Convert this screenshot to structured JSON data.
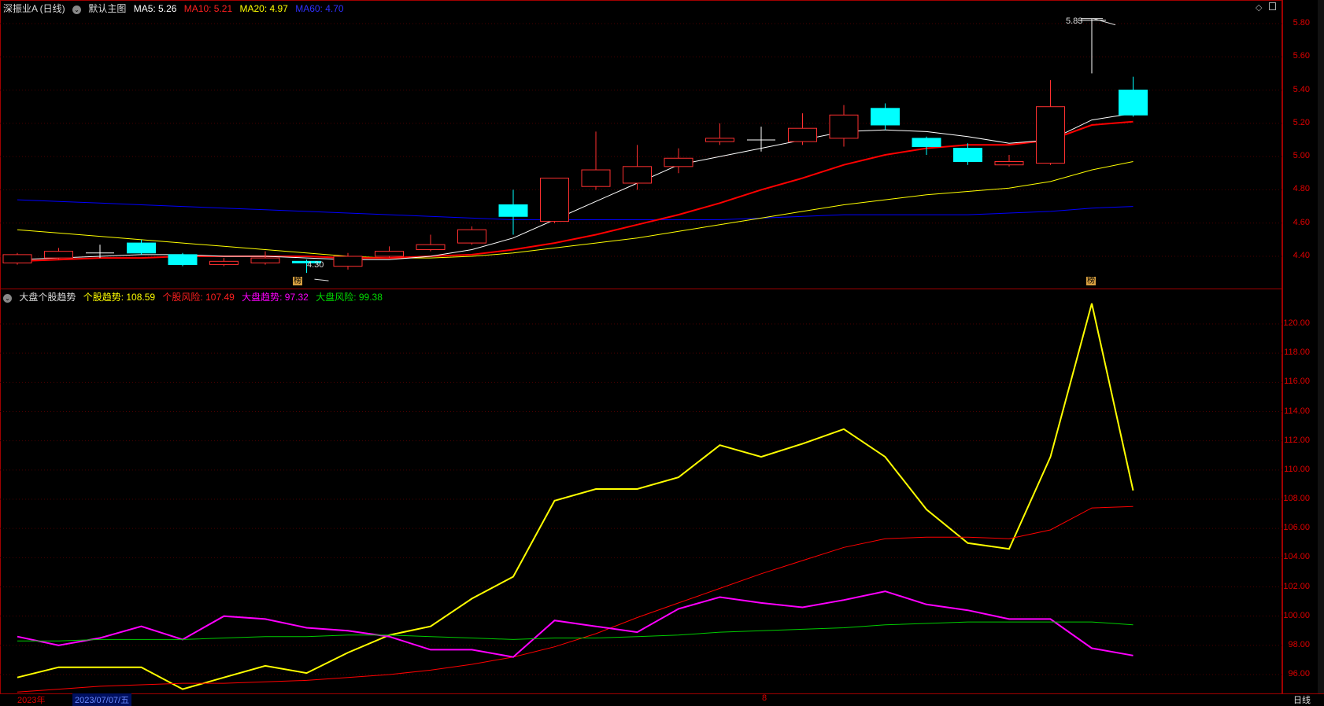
{
  "top_header": {
    "stock_name": "深振业A (日线)",
    "indicator_name": "默认主图",
    "ma5": "MA5: 5.26",
    "ma10": "MA10: 5.21",
    "ma20": "MA20: 4.97",
    "ma60": "MA60: 4.70"
  },
  "bottom_header": {
    "indicator_name": "大盘个股趋势",
    "stock_trend": "个股趋势: 108.59",
    "stock_risk": "个股风险: 107.49",
    "market_trend": "大盘趋势: 97.32",
    "market_risk": "大盘风险: 99.38"
  },
  "price_axis": [
    "5.80",
    "5.60",
    "5.40",
    "5.20",
    "5.00",
    "4.80",
    "4.60",
    "4.40"
  ],
  "indicator_axis": [
    "120.00",
    "118.00",
    "116.00",
    "114.00",
    "112.00",
    "110.00",
    "108.00",
    "106.00",
    "104.00",
    "102.00",
    "100.00",
    "98.00",
    "96.00"
  ],
  "annotations": {
    "high_label": "5.83",
    "low_label": "4.30",
    "tag_left": "榜",
    "tag_right": "榜"
  },
  "footer": {
    "year": "2023年",
    "date": "2023/07/07/五",
    "mid_marker": "8",
    "period": "日线"
  },
  "colors": {
    "up": "#ff3030",
    "down": "#00ffff",
    "ma5": "#ffffff",
    "ma10": "#ff0000",
    "ma20": "#ffff00",
    "ma60": "#0000ff",
    "stock_trend": "#ffff00",
    "stock_risk": "#ff0000",
    "market_trend": "#ff00ff",
    "market_risk": "#00cc00"
  },
  "chart_data": [
    {
      "type": "candlestick",
      "ylim": [
        4.3,
        5.85
      ],
      "candles": [
        {
          "o": 4.36,
          "c": 4.41,
          "h": 4.42,
          "l": 4.35
        },
        {
          "o": 4.39,
          "c": 4.43,
          "h": 4.45,
          "l": 4.38
        },
        {
          "o": 4.42,
          "c": 4.42,
          "h": 4.47,
          "l": 4.39
        },
        {
          "o": 4.48,
          "c": 4.42,
          "h": 4.5,
          "l": 4.41
        },
        {
          "o": 4.41,
          "c": 4.35,
          "h": 4.42,
          "l": 4.34
        },
        {
          "o": 4.35,
          "c": 4.37,
          "h": 4.39,
          "l": 4.34
        },
        {
          "o": 4.36,
          "c": 4.39,
          "h": 4.43,
          "l": 4.35
        },
        {
          "o": 4.37,
          "c": 4.36,
          "h": 4.38,
          "l": 4.3
        },
        {
          "o": 4.34,
          "c": 4.4,
          "h": 4.42,
          "l": 4.32
        },
        {
          "o": 4.4,
          "c": 4.43,
          "h": 4.46,
          "l": 4.39
        },
        {
          "o": 4.44,
          "c": 4.47,
          "h": 4.53,
          "l": 4.43
        },
        {
          "o": 4.48,
          "c": 4.56,
          "h": 4.58,
          "l": 4.47
        },
        {
          "o": 4.71,
          "c": 4.64,
          "h": 4.8,
          "l": 4.53
        },
        {
          "o": 4.61,
          "c": 4.87,
          "h": 4.87,
          "l": 4.6
        },
        {
          "o": 4.82,
          "c": 4.92,
          "h": 5.15,
          "l": 4.8
        },
        {
          "o": 4.84,
          "c": 4.94,
          "h": 5.07,
          "l": 4.8
        },
        {
          "o": 4.94,
          "c": 4.99,
          "h": 5.05,
          "l": 4.9
        },
        {
          "o": 5.09,
          "c": 5.11,
          "h": 5.2,
          "l": 5.07
        },
        {
          "o": 5.1,
          "c": 5.1,
          "h": 5.18,
          "l": 5.03
        },
        {
          "o": 5.09,
          "c": 5.17,
          "h": 5.26,
          "l": 5.07
        },
        {
          "o": 5.11,
          "c": 5.25,
          "h": 5.31,
          "l": 5.06
        },
        {
          "o": 5.29,
          "c": 5.19,
          "h": 5.32,
          "l": 5.16
        },
        {
          "o": 5.11,
          "c": 5.06,
          "h": 5.12,
          "l": 5.01
        },
        {
          "o": 5.05,
          "c": 4.97,
          "h": 5.08,
          "l": 4.95
        },
        {
          "o": 4.95,
          "c": 4.97,
          "h": 5.01,
          "l": 4.94
        },
        {
          "o": 4.96,
          "c": 5.3,
          "h": 5.46,
          "l": 4.95
        },
        {
          "o": 5.82,
          "c": 5.82,
          "h": 5.83,
          "l": 5.5
        },
        {
          "o": 5.4,
          "c": 5.25,
          "h": 5.48,
          "l": 5.24
        }
      ],
      "ma5": [
        4.38,
        4.39,
        4.4,
        4.41,
        4.41,
        4.4,
        4.4,
        4.39,
        4.38,
        4.38,
        4.4,
        4.44,
        4.51,
        4.62,
        4.73,
        4.84,
        4.95,
        5.0,
        5.05,
        5.1,
        5.15,
        5.16,
        5.15,
        5.12,
        5.08,
        5.1,
        5.22,
        5.26
      ],
      "ma10": [
        4.37,
        4.38,
        4.39,
        4.39,
        4.4,
        4.4,
        4.4,
        4.4,
        4.39,
        4.39,
        4.4,
        4.41,
        4.44,
        4.48,
        4.53,
        4.59,
        4.65,
        4.72,
        4.8,
        4.87,
        4.95,
        5.01,
        5.05,
        5.07,
        5.07,
        5.1,
        5.19,
        5.21
      ],
      "ma20": [
        4.56,
        4.54,
        4.52,
        4.5,
        4.48,
        4.46,
        4.44,
        4.42,
        4.4,
        4.39,
        4.39,
        4.4,
        4.42,
        4.45,
        4.48,
        4.51,
        4.55,
        4.59,
        4.63,
        4.67,
        4.71,
        4.74,
        4.77,
        4.79,
        4.81,
        4.85,
        4.92,
        4.97
      ],
      "ma60": [
        4.74,
        4.73,
        4.72,
        4.71,
        4.7,
        4.69,
        4.68,
        4.67,
        4.66,
        4.65,
        4.64,
        4.63,
        4.62,
        4.62,
        4.62,
        4.62,
        4.62,
        4.62,
        4.63,
        4.64,
        4.65,
        4.65,
        4.65,
        4.65,
        4.66,
        4.67,
        4.69,
        4.7
      ]
    },
    {
      "type": "line",
      "ylim": [
        94.8,
        122.5
      ],
      "series": [
        {
          "name": "个股趋势",
          "values": [
            95.8,
            96.5,
            96.5,
            96.5,
            95.0,
            95.8,
            96.6,
            96.1,
            97.5,
            98.7,
            99.3,
            101.2,
            102.7,
            107.9,
            108.7,
            108.7,
            109.5,
            111.7,
            110.9,
            111.8,
            112.8,
            110.9,
            107.3,
            105.0,
            104.6,
            110.9,
            121.4,
            108.6
          ]
        },
        {
          "name": "个股风险",
          "values": [
            94.8,
            95.0,
            95.2,
            95.3,
            95.4,
            95.4,
            95.5,
            95.6,
            95.8,
            96.0,
            96.3,
            96.7,
            97.2,
            97.9,
            98.8,
            99.9,
            100.9,
            101.9,
            102.9,
            103.8,
            104.7,
            105.3,
            105.4,
            105.4,
            105.3,
            105.9,
            107.4,
            107.5
          ]
        },
        {
          "name": "大盘趋势",
          "values": [
            98.6,
            98.0,
            98.5,
            99.3,
            98.4,
            100.0,
            99.8,
            99.2,
            99.0,
            98.6,
            97.7,
            97.7,
            97.2,
            99.7,
            99.3,
            98.9,
            100.5,
            101.3,
            100.9,
            100.6,
            101.1,
            101.7,
            100.8,
            100.4,
            99.8,
            99.8,
            97.8,
            97.3
          ]
        },
        {
          "name": "大盘风险",
          "values": [
            98.3,
            98.3,
            98.4,
            98.4,
            98.4,
            98.5,
            98.6,
            98.6,
            98.7,
            98.7,
            98.6,
            98.5,
            98.4,
            98.5,
            98.5,
            98.6,
            98.7,
            98.9,
            99.0,
            99.1,
            99.2,
            99.4,
            99.5,
            99.6,
            99.6,
            99.6,
            99.6,
            99.4
          ]
        }
      ]
    }
  ]
}
